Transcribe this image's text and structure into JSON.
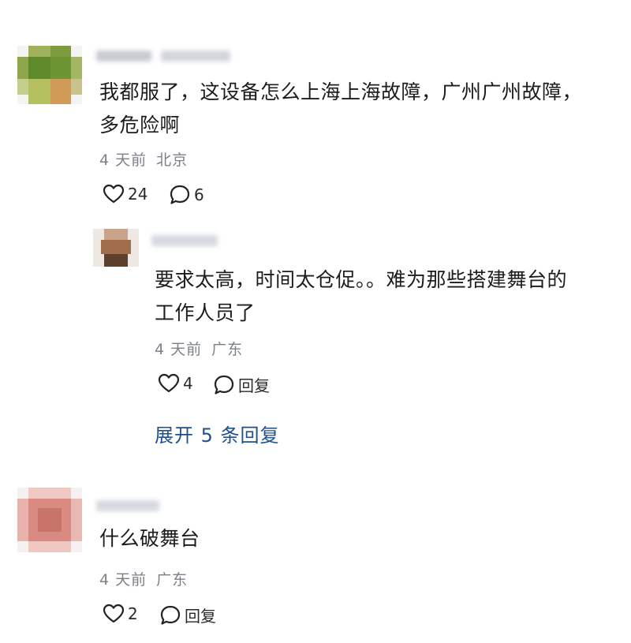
{
  "comments": [
    {
      "text_line1": "我都服了，这设备怎么上海上海故障，广州广州故障，",
      "text_line2": "多危险啊",
      "time": "4 天前",
      "location": "北京",
      "likes": "24",
      "replies": "6"
    },
    {
      "text_line1": "要求太高，时间太仓促。。难为那些搭建舞台的",
      "text_line2": "工作人员了",
      "time": "4 天前",
      "location": "广东",
      "likes": "4",
      "reply_label": "回复"
    },
    {
      "text_line1": "什么破舞台",
      "time": "4 天前",
      "location": "广东",
      "likes": "2",
      "reply_label": "回复"
    }
  ],
  "expand_replies": "展开 5 条回复",
  "icons": {
    "like": "heart-icon",
    "comment": "comment-bubble-icon"
  },
  "colors": {
    "link": "#1f4f8f",
    "meta": "#7c8089"
  }
}
